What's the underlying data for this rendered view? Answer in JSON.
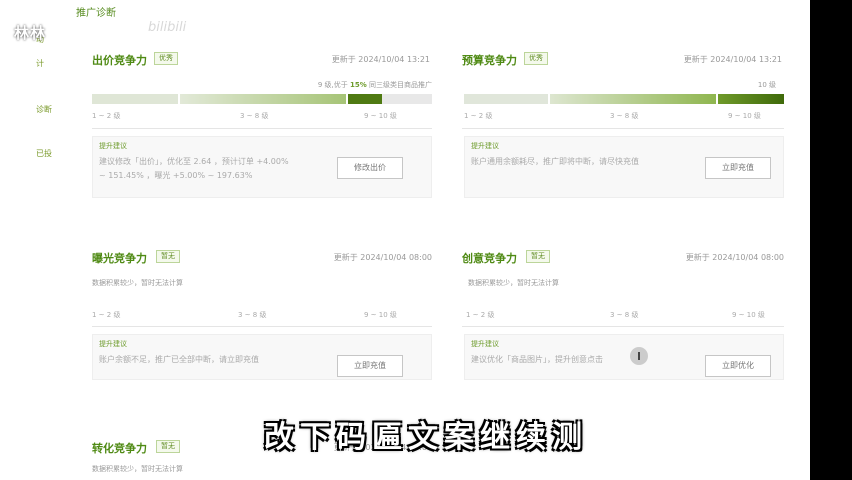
{
  "colors": {
    "accent": "#6d9b2b",
    "bar_light": "#dfe8d2",
    "bar_mid": "#a9c77a",
    "bar_dark": "#4f7a12",
    "text_muted": "#999999"
  },
  "watermark": {
    "left_text": "林林",
    "bilibili": "bilibili"
  },
  "sidebar": {
    "items": [
      {
        "label": "动"
      },
      {
        "label": "计"
      },
      {
        "label": "诊断"
      },
      {
        "label": "已投"
      }
    ]
  },
  "page": {
    "title": "推广诊断"
  },
  "cards": {
    "bid": {
      "title": "出价竞争力",
      "badge": "优秀",
      "updated": "更新于 2024/10/04 13:21",
      "rank_note_pre": "9 级,优于",
      "rank_note_pct": "15%",
      "rank_note_post": "同三级类目商品推广",
      "level_fill": 0.9,
      "ticks": [
        "1 ~ 2 级",
        "3 ~ 8 级",
        "9 ~ 10 级"
      ],
      "suggestion_title": "提升建议",
      "suggestion_line1": "建议修改「出价」，优化至 2.64 ，预计订单 +4.00%",
      "suggestion_line2": "~ 151.45% ，曝光 +5.00% ~ 197.63%",
      "button": "修改出价"
    },
    "budget": {
      "title": "预算竞争力",
      "badge": "优秀",
      "updated": "更新于 2024/10/04 13:21",
      "rank_note": "10 级",
      "level_fill": 1.0,
      "ticks": [
        "1 ~ 2 级",
        "3 ~ 8 级",
        "9 ~ 10 级"
      ],
      "suggestion_title": "提升建议",
      "suggestion_line1": "账户通用余额耗尽，推广即将中断，请尽快充值",
      "button": "立即充值"
    },
    "exposure": {
      "title": "曝光竞争力",
      "badge": "暂无",
      "updated": "更新于 2024/10/04 08:00",
      "no_data": "数据积累较少，暂时无法计算",
      "ticks": [
        "1 ~ 2 级",
        "3 ~ 8 级",
        "9 ~ 10 级"
      ],
      "suggestion_title": "提升建议",
      "suggestion_line1": "账户余额不足，推广已全部中断，请立即充值",
      "button": "立即充值"
    },
    "creative": {
      "title": "创意竞争力",
      "badge": "暂无",
      "updated": "更新于 2024/10/04 08:00",
      "no_data": "数据积累较少，暂时无法计算",
      "ticks": [
        "1 ~ 2 级",
        "3 ~ 8 级",
        "9 ~ 10 级"
      ],
      "suggestion_title": "提升建议",
      "suggestion_line1": "建议优化「商品图片」，提升创意点击",
      "button": "立即优化"
    },
    "conversion": {
      "title": "转化竞争力",
      "badge": "暂无",
      "updated": "更新于 2024/10/04 08:00",
      "no_data": "数据积累较少，暂时无法计算"
    }
  },
  "subtitle": "改下码匾文案继续测"
}
